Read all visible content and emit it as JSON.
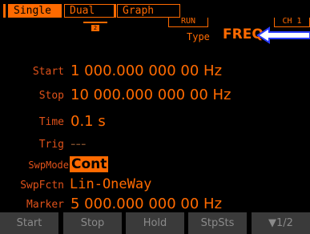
{
  "tabs": [
    {
      "label": "Single",
      "active": true
    },
    {
      "label": "Dual",
      "active": false
    },
    {
      "label": "Graph",
      "active": false
    }
  ],
  "indicators": {
    "channel_small": "2",
    "run_status": "RUN",
    "channel": "CH 1"
  },
  "type": {
    "label": "Type",
    "value": "FREQ"
  },
  "params": {
    "start": {
      "label": "Start",
      "value": "1 000.000 000 00 Hz"
    },
    "stop": {
      "label": "Stop",
      "value": "10 000.000 000 00 Hz"
    },
    "time": {
      "label": "Time",
      "value": "0.1 s"
    },
    "trig": {
      "label": "Trig",
      "value": "---"
    },
    "swpmode": {
      "label": "SwpMode",
      "value": "Cont"
    },
    "swpfctn": {
      "label": "SwpFctn",
      "value": "Lin-OneWay"
    },
    "marker": {
      "label": "Marker",
      "value": "5 000.000 000 00 Hz"
    }
  },
  "softkeys": [
    "Start",
    "Stop",
    "Hold",
    "StpSts",
    "▼1/2"
  ],
  "colors": {
    "accent": "#ff6a00",
    "label": "#e0521a",
    "background": "#000000",
    "softkey_bg": "#3a3a3a",
    "softkey_text": "#8a8a8a",
    "arrow": "#ffffff"
  }
}
